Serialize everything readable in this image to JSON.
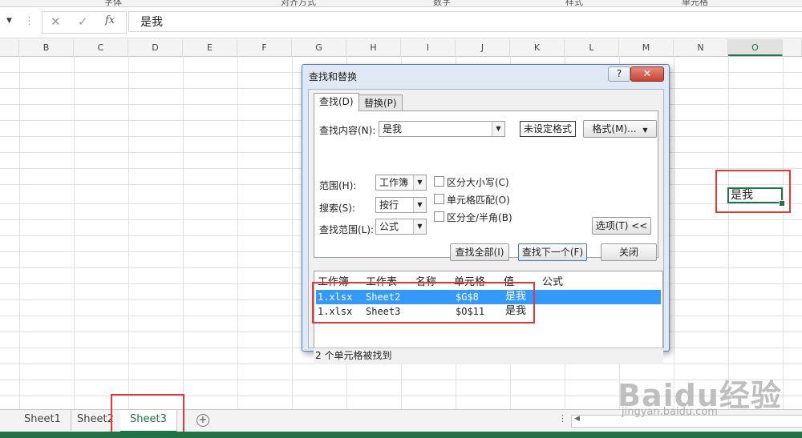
{
  "ribbon_groups": [
    "字体",
    "对齐方式",
    "数字",
    "样式",
    "单元格"
  ],
  "formula_bar": {
    "cancel_glyph": "✕",
    "enter_glyph": "✓",
    "fx_glyph": "fx",
    "value": "是我"
  },
  "columns": [
    "B",
    "C",
    "D",
    "E",
    "F",
    "G",
    "H",
    "I",
    "J",
    "K",
    "L",
    "M",
    "N",
    "O"
  ],
  "selected_column": "O",
  "active_cell_value": "是我",
  "dialog": {
    "title": "查找和替换",
    "help": "?",
    "close": "✕",
    "tabs": [
      "查找(D)",
      "替换(P)"
    ],
    "find_label": "查找内容(N):",
    "find_value": "是我",
    "no_format": "未设定格式",
    "format_button": "格式(M)...",
    "scope_label": "范围(H):",
    "scope_value": "工作簿",
    "search_label": "搜索(S):",
    "search_value": "按行",
    "lookin_label": "查找范围(L):",
    "lookin_value": "公式",
    "match_case": "区分大小写(C)",
    "match_entire": "单元格匹配(O)",
    "match_width": "区分全/半角(B)",
    "options_button": "选项(T) <<",
    "find_all": "查找全部(I)",
    "find_next": "查找下一个(F)",
    "close_button": "关闭",
    "results_headers": [
      "工作簿",
      "工作表",
      "名称",
      "单元格",
      "值",
      "公式"
    ],
    "results": [
      {
        "workbook": "1.xlsx",
        "sheet": "Sheet2",
        "name": "",
        "cell": "$G$8",
        "value": "是我",
        "formula": ""
      },
      {
        "workbook": "1.xlsx",
        "sheet": "Sheet3",
        "name": "",
        "cell": "$O$11",
        "value": "是我",
        "formula": ""
      }
    ],
    "status": "2 个单元格被找到"
  },
  "sheets": [
    "Sheet1",
    "Sheet2",
    "Sheet3"
  ],
  "active_sheet": "Sheet3",
  "add_sheet": "+",
  "watermark": {
    "text": "Baidu经验",
    "url": "jingyan.baidu.com"
  }
}
